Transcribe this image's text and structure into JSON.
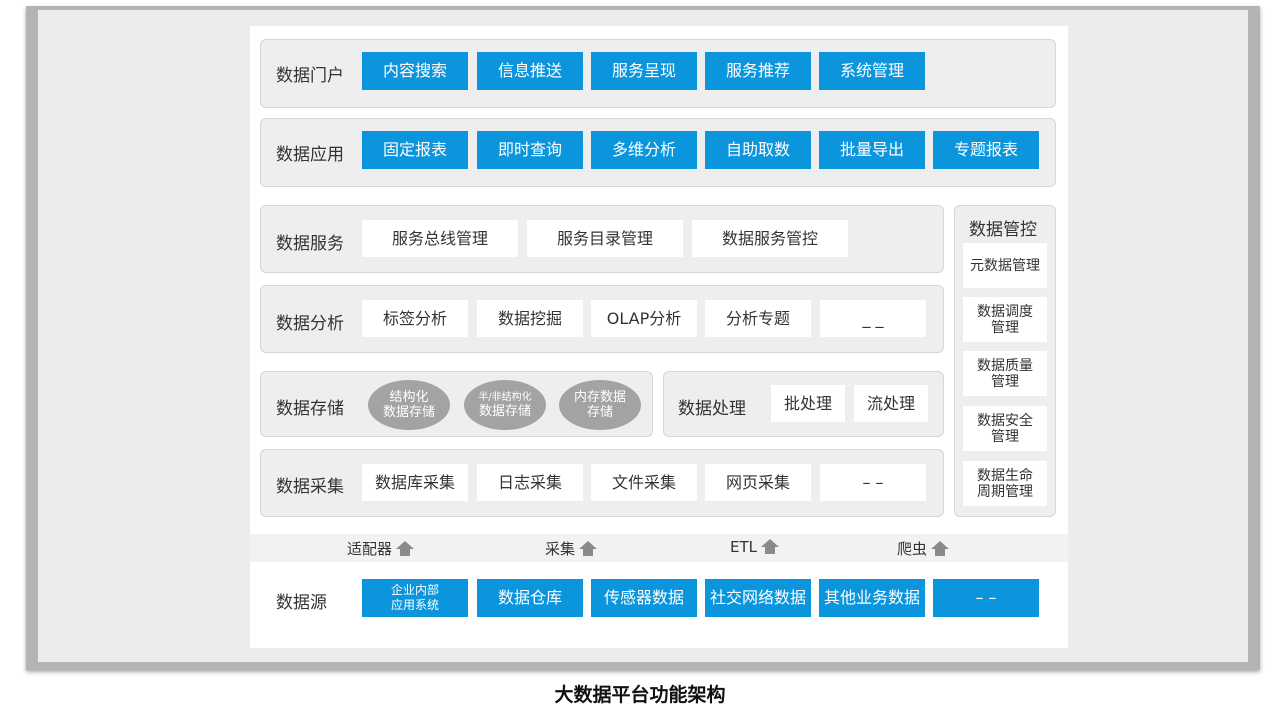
{
  "portal": {
    "label": "数据门户",
    "items": [
      "内容搜索",
      "信息推送",
      "服务呈现",
      "服务推荐",
      "系统管理"
    ]
  },
  "application": {
    "label": "数据应用",
    "items": [
      "固定报表",
      "即时查询",
      "多维分析",
      "自助取数",
      "批量导出",
      "专题报表"
    ]
  },
  "service": {
    "label": "数据服务",
    "items": [
      "服务总线管理",
      "服务目录管理",
      "数据服务管控"
    ]
  },
  "analysis": {
    "label": "数据分析",
    "items": [
      "标签分析",
      "数据挖掘",
      "OLAP分析",
      "分析专题",
      "_ _"
    ]
  },
  "storage": {
    "label": "数据存储",
    "items": [
      {
        "line1": "结构化",
        "line2": "数据存储"
      },
      {
        "line1": "半/非结构化",
        "line2": "数据存储"
      },
      {
        "line1": "内存数据",
        "line2": "存储"
      }
    ]
  },
  "processing": {
    "label": "数据处理",
    "items": [
      "批处理",
      "流处理"
    ]
  },
  "collection": {
    "label": "数据采集",
    "items": [
      "数据库采集",
      "日志采集",
      "文件采集",
      "网页采集",
      "– –"
    ]
  },
  "governance": {
    "label": "数据管控",
    "items": [
      {
        "line1": "元数据管理",
        "line2": ""
      },
      {
        "line1": "数据调度",
        "line2": "管理"
      },
      {
        "line1": "数据质量",
        "line2": "管理"
      },
      {
        "line1": "数据安全",
        "line2": "管理"
      },
      {
        "line1": "数据生命",
        "line2": "周期管理"
      }
    ]
  },
  "adapters": [
    "适配器",
    "采集",
    "ETL",
    "爬虫"
  ],
  "sources": {
    "label": "数据源",
    "first": {
      "line1": "企业内部",
      "line2": "应用系统"
    },
    "items": [
      "数据仓库",
      "传感器数据",
      "社交网络数据",
      "其他业务数据",
      "– –"
    ]
  },
  "caption": "大数据平台功能架构",
  "colors": {
    "accent_blue": "#0b95dc",
    "panel_gray": "#eeeeee",
    "ellipse_gray": "#a3a3a3",
    "arrow_gray": "#8a8a8a"
  },
  "icons": {
    "adapter_arrow": "house-up-arrow-icon"
  }
}
